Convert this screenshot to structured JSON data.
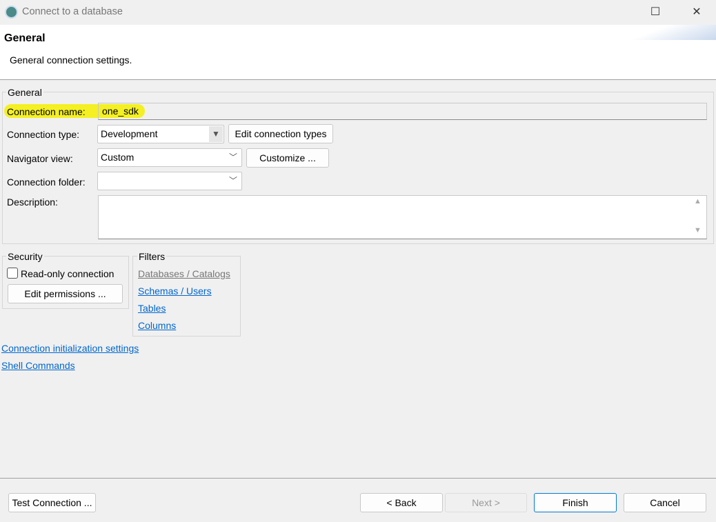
{
  "window": {
    "title": "Connect to a database",
    "maximize_icon": "maximize-icon",
    "close_icon": "close-icon"
  },
  "header": {
    "title": "General",
    "description": "General connection settings."
  },
  "general": {
    "legend": "General",
    "connection_name_label": "Connection name:",
    "connection_name_value": "one_sdk",
    "connection_type_label": "Connection type:",
    "connection_type_value": "Development",
    "edit_connection_types": "Edit connection types",
    "navigator_view_label": "Navigator view:",
    "navigator_view_value": "Custom",
    "customize": "Customize ...",
    "connection_folder_label": "Connection folder:",
    "connection_folder_value": "",
    "description_label": "Description:",
    "description_value": ""
  },
  "security": {
    "legend": "Security",
    "read_only_label": "Read-only connection",
    "read_only_checked": false,
    "edit_permissions": "Edit permissions ..."
  },
  "filters": {
    "legend": "Filters",
    "items": [
      "Databases / Catalogs",
      "Schemas / Users",
      "Tables",
      "Columns"
    ]
  },
  "links": {
    "init_settings": "Connection initialization settings",
    "shell_commands": "Shell Commands"
  },
  "footer": {
    "test_connection": "Test Connection ...",
    "back": "< Back",
    "next": "Next >",
    "finish": "Finish",
    "cancel": "Cancel"
  },
  "colors": {
    "link": "#0066cc",
    "highlight": "#f5f000",
    "finish_border": "#0078d4"
  }
}
